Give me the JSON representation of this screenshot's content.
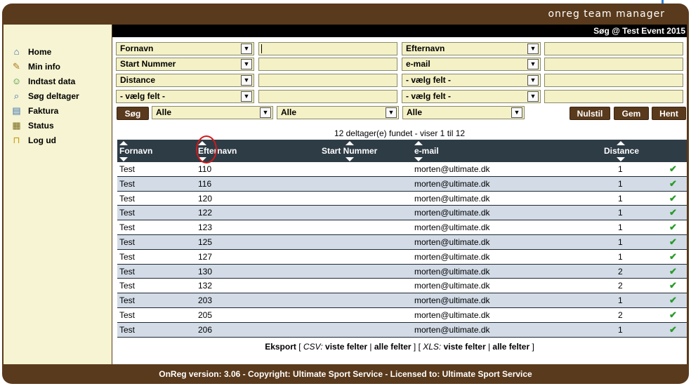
{
  "header": {
    "app_title": "onreg team manager"
  },
  "sidebar": {
    "items": [
      {
        "label": "Home",
        "icon": "home-icon",
        "glyph": "⌂"
      },
      {
        "label": "Min info",
        "icon": "notepad-icon",
        "glyph": "✎"
      },
      {
        "label": "Indtast data",
        "icon": "add-user-icon",
        "glyph": "☺"
      },
      {
        "label": "Søg deltager",
        "icon": "search-icon",
        "glyph": "⌕"
      },
      {
        "label": "Faktura",
        "icon": "invoice-icon",
        "glyph": "▤"
      },
      {
        "label": "Status",
        "icon": "chart-icon",
        "glyph": "▦"
      },
      {
        "label": "Log ud",
        "icon": "lock-icon",
        "glyph": "⊓"
      }
    ]
  },
  "page": {
    "title": "Søg @ Test Event 2015"
  },
  "search": {
    "field_selects": [
      "Fornavn",
      "Start Nummer",
      "Distance",
      "- vælg felt -",
      "Efternavn",
      "e-mail",
      "- vælg felt -",
      "- vælg felt -"
    ],
    "filter_selects": [
      "Alle",
      "Alle",
      "Alle"
    ],
    "search_button": "Søg",
    "reset_button": "Nulstil",
    "save_button": "Gem",
    "load_button": "Hent"
  },
  "results": {
    "summary": "12 deltager(e) fundet - viser 1 til 12",
    "columns": [
      "Fornavn",
      "Efternavn",
      "Start Nummer",
      "e-mail",
      "Distance"
    ],
    "rows": [
      {
        "fornavn": "Test",
        "efternavn": "110",
        "start": "",
        "email": "morten@ultimate.dk",
        "distance": "1"
      },
      {
        "fornavn": "Test",
        "efternavn": "116",
        "start": "",
        "email": "morten@ultimate.dk",
        "distance": "1"
      },
      {
        "fornavn": "Test",
        "efternavn": "120",
        "start": "",
        "email": "morten@ultimate.dk",
        "distance": "1"
      },
      {
        "fornavn": "Test",
        "efternavn": "122",
        "start": "",
        "email": "morten@ultimate.dk",
        "distance": "1"
      },
      {
        "fornavn": "Test",
        "efternavn": "123",
        "start": "",
        "email": "morten@ultimate.dk",
        "distance": "1"
      },
      {
        "fornavn": "Test",
        "efternavn": "125",
        "start": "",
        "email": "morten@ultimate.dk",
        "distance": "1"
      },
      {
        "fornavn": "Test",
        "efternavn": "127",
        "start": "",
        "email": "morten@ultimate.dk",
        "distance": "1"
      },
      {
        "fornavn": "Test",
        "efternavn": "130",
        "start": "",
        "email": "morten@ultimate.dk",
        "distance": "2"
      },
      {
        "fornavn": "Test",
        "efternavn": "132",
        "start": "",
        "email": "morten@ultimate.dk",
        "distance": "2"
      },
      {
        "fornavn": "Test",
        "efternavn": "203",
        "start": "",
        "email": "morten@ultimate.dk",
        "distance": "1"
      },
      {
        "fornavn": "Test",
        "efternavn": "205",
        "start": "",
        "email": "morten@ultimate.dk",
        "distance": "2"
      },
      {
        "fornavn": "Test",
        "efternavn": "206",
        "start": "",
        "email": "morten@ultimate.dk",
        "distance": "1"
      }
    ],
    "check_glyph": "✔"
  },
  "export": {
    "label": "Eksport",
    "csv": "CSV:",
    "xls": "XLS:",
    "visible_fields": "viste felter",
    "all_fields": "alle felter"
  },
  "footer": {
    "text": "OnReg version: 3.06 - Copyright: Ultimate Sport Service - Licensed to: Ultimate Sport Service"
  },
  "colors": {
    "brand_brown": "#5a3a1c",
    "sidebar_bg": "#f6f4d2",
    "table_header": "#2e3c46",
    "row_alt": "#d2dbe6",
    "check_green": "#2a9a2a",
    "highlight_ring": "#d21a1a"
  }
}
